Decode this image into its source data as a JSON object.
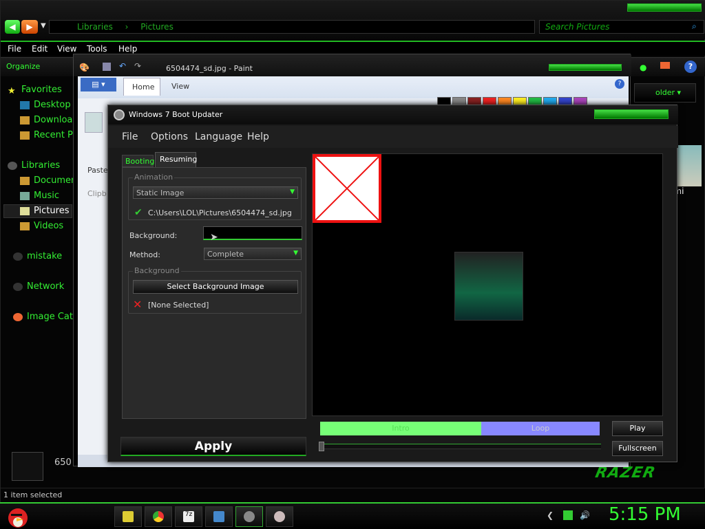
{
  "explorer": {
    "address": [
      "Libraries",
      "Pictures"
    ],
    "search_placeholder": "Search Pictures",
    "menu": [
      "File",
      "Edit",
      "View",
      "Tools",
      "Help"
    ],
    "organize": "Organize",
    "nav": {
      "favorites": "Favorites",
      "desktop": "Desktop",
      "downloads": "Downloa",
      "recent": "Recent P",
      "libraries": "Libraries",
      "documents": "Documen",
      "music": "Music",
      "pictures": "Pictures",
      "videos": "Videos",
      "mistake": "mistake",
      "network": "Network",
      "image_catalog": "Image Cata"
    },
    "folder_button": "older",
    "right_thumb_label": "yrami",
    "status": "1 item selected",
    "file_name": "650",
    "brand": "RAZER"
  },
  "paint": {
    "title": "6504474_sd.jpg - Paint",
    "tab_home": "Home",
    "tab_view": "View",
    "paste": "Paste",
    "clipboard": "Clipb"
  },
  "boot": {
    "title": "Windows 7 Boot Updater",
    "menu": [
      "File",
      "Options",
      "Language",
      "Help"
    ],
    "tab_booting": "Booting",
    "tab_resuming": "Resuming",
    "animation_group": "Animation",
    "animation_value": "Static Image",
    "image_path": "C:\\Users\\LOL\\Pictures\\6504474_sd.jpg",
    "background_label": "Background:",
    "method_label": "Method:",
    "method_value": "Complete",
    "background_group": "Background",
    "select_bg_button": "Select Background Image",
    "none_selected": "[None Selected]",
    "apply": "Apply",
    "bar_intro": "Intro",
    "bar_loop": "Loop",
    "play": "Play",
    "fullscreen": "Fullscreen"
  },
  "taskbar": {
    "clock": "5:15 PM"
  },
  "colors": {
    "accent": "#33ff33",
    "intro_bar": "#77ff77",
    "loop_bar": "#8888ff",
    "placeholder_x": "#ee1111"
  }
}
